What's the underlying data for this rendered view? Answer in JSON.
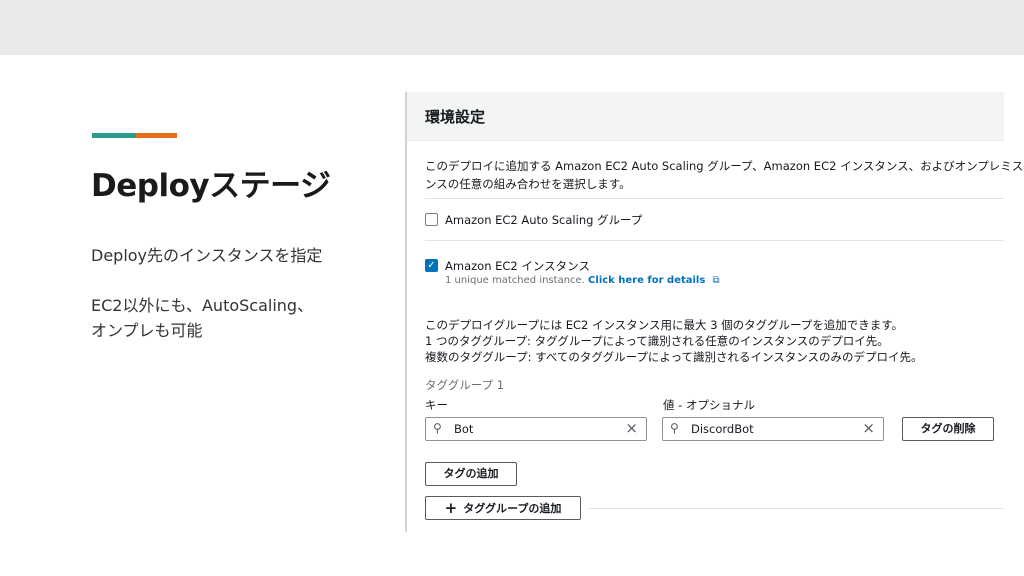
{
  "slide": {
    "title": "Deployステージ",
    "body_line1": "Deploy先のインスタンスを指定",
    "body_line2": "EC2以外にも、AutoScaling、",
    "body_line3": "オンプレも可能"
  },
  "panel": {
    "header": "環境設定",
    "intro_line1": "このデプロイに追加する Amazon EC2 Auto Scaling グループ、Amazon EC2 インスタンス、およびオンプレミス-",
    "intro_line2": "ンスの任意の組み合わせを選択します。",
    "option_asg_label": "Amazon EC2 Auto Scaling グループ",
    "option_ec2_label": "Amazon EC2 インスタンス",
    "match_text": "1 unique matched instance.",
    "match_link": "Click here for details",
    "info_line1": "このデプロイグループには EC2 インスタンス用に最大 3 個のタググループを追加できます。",
    "info_line2": "1 つのタググループ: タググループによって識別される任意のインスタンスのデプロイ先。",
    "info_line3": "複数のタググループ: すべてのタググループによって識別されるインスタンスのみのデプロイ先。",
    "tag_group_label": "タググループ 1",
    "key_label": "キー",
    "value_label": "値 - オプショナル",
    "key_value": "Bot",
    "value_value": "DiscordBot",
    "remove_tag_button": "タグの削除",
    "add_tag_button": "タグの追加",
    "add_tag_group_button": "タググループの追加"
  },
  "colors": {
    "accent_teal": "#2a9d8f",
    "accent_orange": "#e76f1c",
    "link": "#0073bb",
    "checkbox": "#0073bb"
  }
}
